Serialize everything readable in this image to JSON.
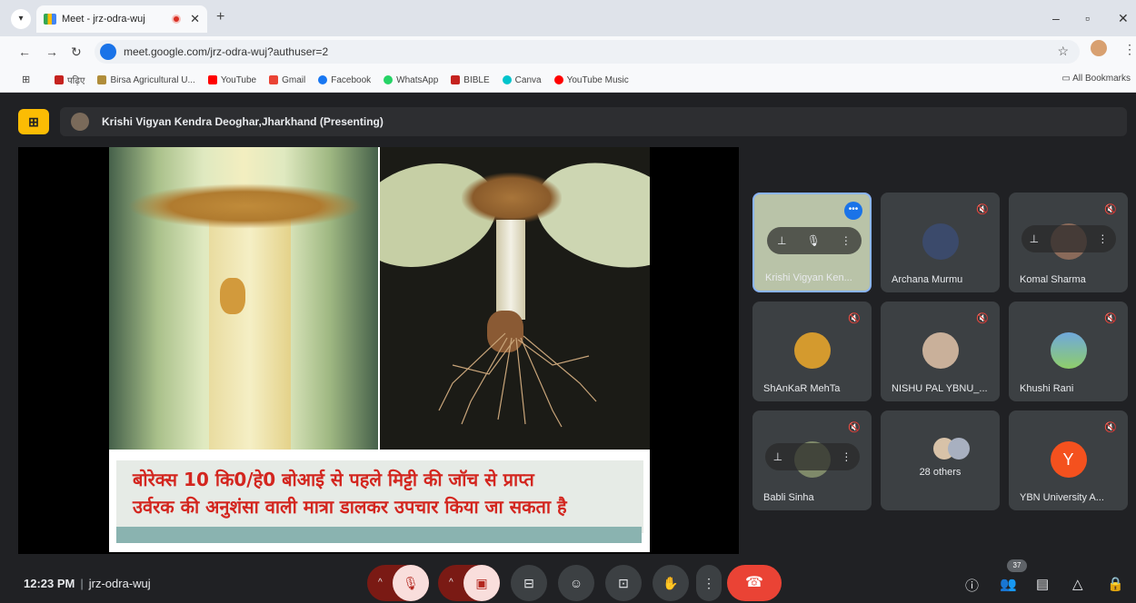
{
  "browser": {
    "tab_title": "Meet - jrz-odra-wuj",
    "tab_close": "✕",
    "new_tab": "+",
    "url": "meet.google.com/jrz-odra-wuj?authuser=2",
    "all_bookmarks": "All Bookmarks",
    "bookmarks": [
      {
        "label": "पढ़िए",
        "color": "#c5221f"
      },
      {
        "label": "Birsa Agricultural U...",
        "color": "#b08d3a"
      },
      {
        "label": "YouTube",
        "color": "#ff0000"
      },
      {
        "label": "Gmail",
        "color": "#ea4335"
      },
      {
        "label": "Facebook",
        "color": "#1877f2"
      },
      {
        "label": "WhatsApp",
        "color": "#25d366"
      },
      {
        "label": "BIBLE",
        "color": "#c5221f"
      },
      {
        "label": "Canva",
        "color": "#00c4cc"
      },
      {
        "label": "YouTube Music",
        "color": "#ff0000"
      }
    ]
  },
  "meet": {
    "presenter_label": "Krishi Vigyan Kendra Deoghar,Jharkhand (Presenting)",
    "slide": {
      "caption_line1": "बोरेक्स 10 कि0/हे0 बोआई से पहले मिट्टी की जॉच से प्राप्त",
      "caption_line2": "उर्वरक की अनुशंसा वाली मात्रा डालकर उपचार किया जा सकता है"
    },
    "participants": [
      {
        "name": "Krishi Vigyan Ken...",
        "active": true
      },
      {
        "name": "Archana Murmu",
        "avatar_color": "#3b4a6b"
      },
      {
        "name": "Komal Sharma",
        "avatar_color": "#8a6a5a"
      },
      {
        "name": "ShAnKaR MehTa",
        "avatar_color": "#d49a2e"
      },
      {
        "name": "NISHU PAL YBNU_...",
        "avatar_color": "#c9b09a"
      },
      {
        "name": "Khushi Rani",
        "avatar_color": "#6fa8dc"
      },
      {
        "name": "Babli Sinha",
        "avatar_color": "#7f8a6a"
      },
      {
        "name": "28 others"
      },
      {
        "name": "YBN University A...",
        "initial": "Y"
      }
    ],
    "bottom": {
      "time": "12:23 PM",
      "meeting_code": "jrz-odra-wuj",
      "people_count": "37"
    }
  }
}
